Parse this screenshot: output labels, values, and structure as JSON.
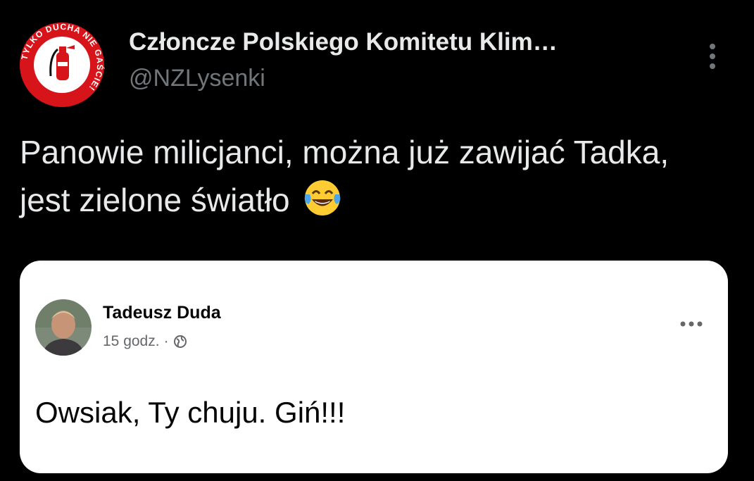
{
  "tweet": {
    "author_name": "Członcze Polskiego Komitetu Klim…",
    "author_handle": "@NZLysenki",
    "text": "Panowie milicjanci, można już zawijać Tadka, jest zielone światło",
    "emoji_icon": "face-with-tears-of-joy-icon",
    "avatar_logo_text": "TYLKO DUCHA NIE GAŚCIE!",
    "more_icon": "vertical-ellipsis-icon"
  },
  "embedded_post": {
    "author_name": "Tadeusz Duda",
    "time": "15 godz.",
    "separator": "·",
    "privacy_icon": "globe-icon",
    "more_icon": "horizontal-ellipsis-icon",
    "text": "Owsiak, Ty chuju. Giń!!!"
  },
  "colors": {
    "background": "#000000",
    "primary_text": "#e7e9ea",
    "secondary_text": "#71767b",
    "logo_red": "#d7141a",
    "card_background": "#ffffff"
  }
}
